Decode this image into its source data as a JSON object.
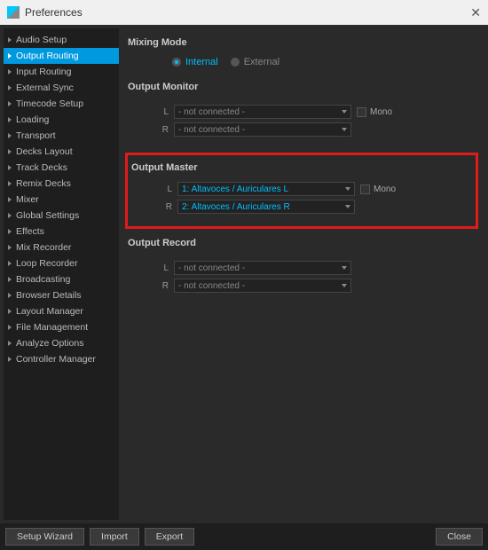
{
  "window": {
    "title": "Preferences"
  },
  "sidebar": {
    "items": [
      {
        "label": "Audio Setup"
      },
      {
        "label": "Output Routing",
        "active": true
      },
      {
        "label": "Input Routing"
      },
      {
        "label": "External Sync"
      },
      {
        "label": "Timecode Setup"
      },
      {
        "label": "Loading"
      },
      {
        "label": "Transport"
      },
      {
        "label": "Decks Layout"
      },
      {
        "label": "Track Decks"
      },
      {
        "label": "Remix Decks"
      },
      {
        "label": "Mixer"
      },
      {
        "label": "Global Settings"
      },
      {
        "label": "Effects"
      },
      {
        "label": "Mix Recorder"
      },
      {
        "label": "Loop Recorder"
      },
      {
        "label": "Broadcasting"
      },
      {
        "label": "Browser Details"
      },
      {
        "label": "Layout Manager"
      },
      {
        "label": "File Management"
      },
      {
        "label": "Analyze Options"
      },
      {
        "label": "Controller Manager"
      }
    ]
  },
  "mixing_mode": {
    "title": "Mixing Mode",
    "options": [
      {
        "label": "Internal",
        "selected": true
      },
      {
        "label": "External",
        "selected": false
      }
    ]
  },
  "output_monitor": {
    "title": "Output Monitor",
    "L": "- not connected -",
    "R": "- not connected -",
    "mono_label": "Mono"
  },
  "output_master": {
    "title": "Output Master",
    "L": "1: Altavoces / Auriculares L",
    "R": "2: Altavoces / Auriculares R",
    "mono_label": "Mono"
  },
  "output_record": {
    "title": "Output Record",
    "L": "- not connected -",
    "R": "- not connected -"
  },
  "labels": {
    "L": "L",
    "R": "R"
  },
  "footer": {
    "setup_wizard": "Setup Wizard",
    "import": "Import",
    "export": "Export",
    "close": "Close"
  }
}
